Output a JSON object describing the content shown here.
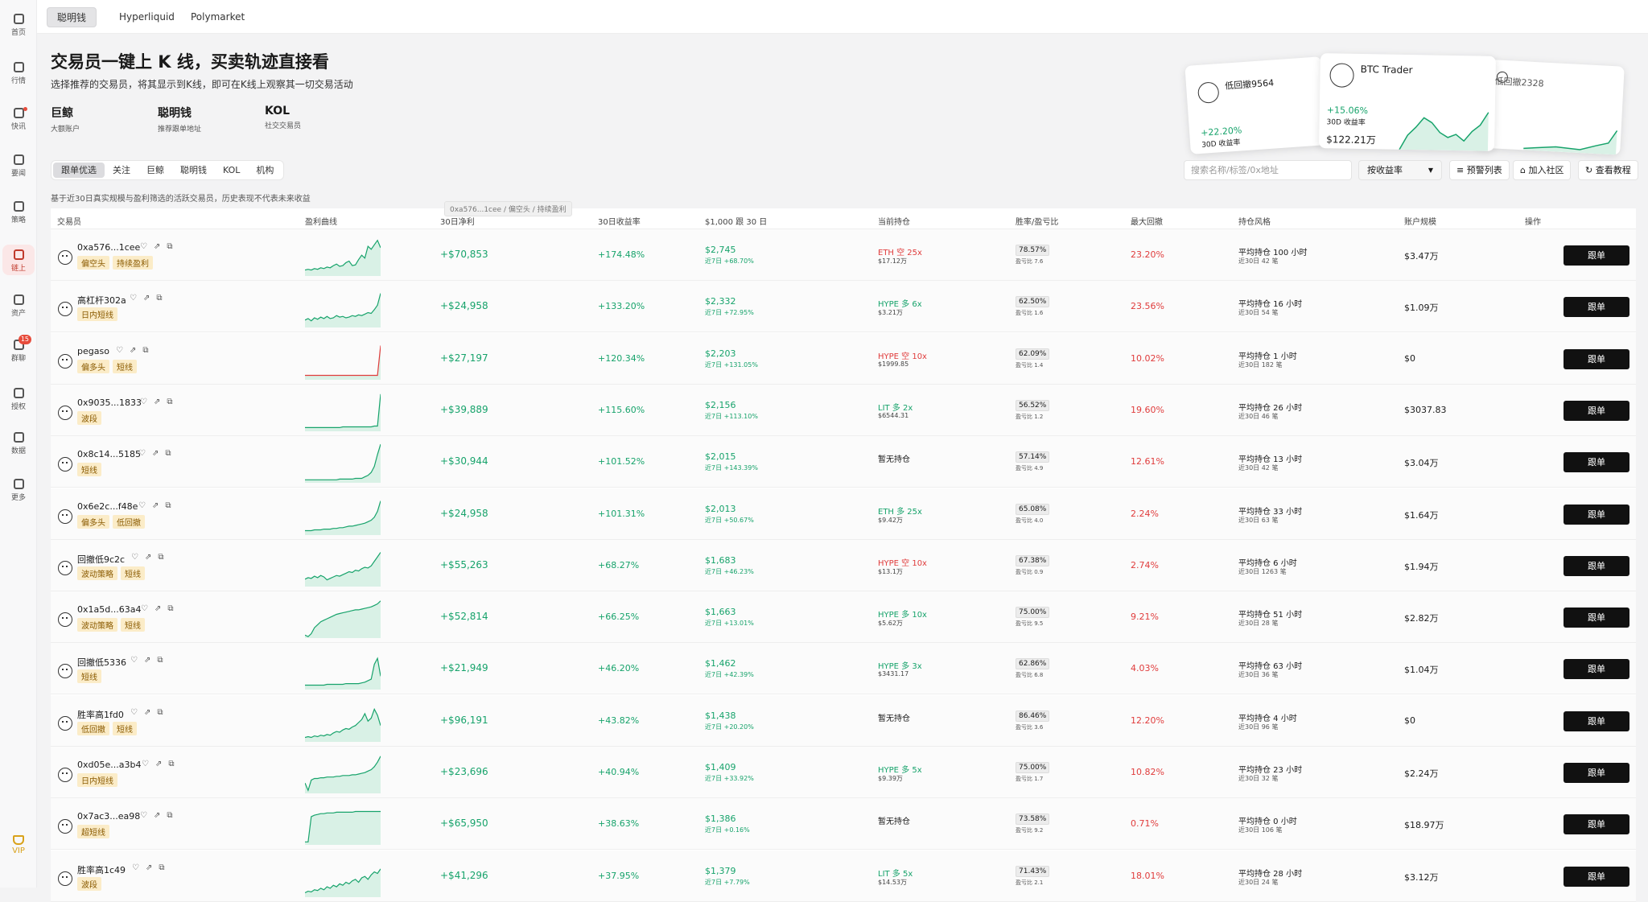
{
  "sidebar": {
    "items": [
      {
        "label": "首页",
        "icon": "home-icon"
      },
      {
        "label": "行情",
        "icon": "chart-icon"
      },
      {
        "label": "快讯",
        "icon": "news-icon"
      },
      {
        "label": "要闻",
        "icon": "article-icon"
      },
      {
        "label": "策略",
        "icon": "robot-icon"
      },
      {
        "label": "链上",
        "icon": "chain-icon"
      },
      {
        "label": "资产",
        "icon": "wallet-icon"
      },
      {
        "label": "群聊",
        "icon": "chat-icon",
        "badge": "15"
      },
      {
        "label": "授权",
        "icon": "auth-icon"
      },
      {
        "label": "数据",
        "icon": "data-icon"
      },
      {
        "label": "更多",
        "icon": "more-icon"
      }
    ],
    "vip": "VIP"
  },
  "top_tabs": [
    "聪明钱",
    "Hyperliquid",
    "Polymarket"
  ],
  "hero": {
    "title": "交易员一键上 K 线，买卖轨迹直接看",
    "subtitle": "选择推荐的交易员，将其显示到K线，即可在K线上观察其一切交易活动",
    "categories": [
      {
        "title": "巨鲸",
        "desc": "大额账户"
      },
      {
        "title": "聪明钱",
        "desc": "推荐跟单地址"
      },
      {
        "title": "KOL",
        "desc": "社交交易员"
      }
    ]
  },
  "cards": [
    {
      "name": "低回撤9564",
      "return": "+22.20%",
      "label": "30D 收益率"
    },
    {
      "name": "BTC Trader",
      "return": "+15.06%",
      "label": "30D 收益率",
      "amount": "$122.21万"
    },
    {
      "name": "低回撤2328"
    }
  ],
  "filters": [
    "跟单优选",
    "关注",
    "巨鲸",
    "聪明钱",
    "KOL",
    "机构"
  ],
  "search_placeholder": "搜索名称/标签/0x地址",
  "sort_label": "按收益率",
  "toolbar": {
    "alert": "预警列表",
    "community": "加入社区",
    "tutorial": "查看教程"
  },
  "note": "基于近30日真实规模与盈利筛选的活跃交易员，历史表现不代表未来收益",
  "tooltip": "0xa576...1cee / 偏空头 / 持续盈利",
  "columns": [
    "交易员",
    "盈利曲线",
    "30日净利",
    "30日收益率",
    "$1,000 跟 30 日",
    "当前持仓",
    "胜率/盈亏比",
    "最大回撤",
    "持仓风格",
    "账户规模",
    "操作"
  ],
  "follow_label": "跟单",
  "rows": [
    {
      "name": "0xa576...1cee",
      "tags": [
        "偏空头",
        "持续盈利"
      ],
      "pnl": "+$70,853",
      "ret": "+174.48%",
      "f1": "$2,745",
      "f2": "近7日 +68.70%",
      "h1": "ETH 空 25x",
      "h1c": "#e03c3c",
      "h2": "$17.12万",
      "wr": "78.57%",
      "pf": "盈亏比 7.6",
      "dd": "23.20%",
      "st1": "平均持仓 100 小时",
      "st2": "近30日 42 笔",
      "size": "$3.47万",
      "spark": [
        8,
        9,
        8,
        10,
        9,
        11,
        10,
        12,
        11,
        14,
        16,
        13,
        14,
        18,
        20,
        14,
        15,
        22,
        28,
        24,
        40,
        36,
        42,
        48,
        38
      ]
    },
    {
      "name": "高杠杆302a",
      "tags": [
        "日内短线"
      ],
      "pnl": "+$24,958",
      "ret": "+133.20%",
      "f1": "$2,332",
      "f2": "近7日 +72.95%",
      "h1": "HYPE 多 6x",
      "h1c": "#17a36b",
      "h2": "$3.21万",
      "wr": "62.50%",
      "pf": "盈亏比 1.6",
      "dd": "23.56%",
      "st1": "平均持仓 16 小时",
      "st2": "近30日 54 笔",
      "size": "$1.09万",
      "spark": [
        10,
        12,
        9,
        13,
        11,
        14,
        12,
        15,
        12,
        13,
        16,
        14,
        15,
        13,
        14,
        16,
        15,
        17,
        16,
        18,
        20,
        19,
        24,
        30,
        46
      ]
    },
    {
      "name": "pegaso",
      "tags": [
        "偏多头",
        "短线"
      ],
      "pnl": "+$27,197",
      "ret": "+120.34%",
      "f1": "$2,203",
      "f2": "近7日 +131.05%",
      "h1": "HYPE 空 10x",
      "h1c": "#e03c3c",
      "h2": "$1999.85",
      "wr": "62.09%",
      "pf": "盈亏比 1.4",
      "dd": "10.02%",
      "st1": "平均持仓 1 小时",
      "st2": "近30日 182 笔",
      "size": "$0",
      "spark": [
        6,
        6,
        6,
        6,
        6,
        6,
        6,
        6,
        6,
        6,
        6,
        6,
        6,
        6,
        6,
        6,
        6,
        6,
        6,
        6,
        6,
        6,
        6,
        6,
        46
      ],
      "red_start": true
    },
    {
      "name": "0x9035...1833",
      "tags": [
        "波段"
      ],
      "pnl": "+$39,889",
      "ret": "+115.60%",
      "f1": "$2,156",
      "f2": "近7日 +113.10%",
      "h1": "LIT 多 2x",
      "h1c": "#17a36b",
      "h2": "$6544.31",
      "wr": "56.52%",
      "pf": "盈亏比 1.2",
      "dd": "19.60%",
      "st1": "平均持仓 26 小时",
      "st2": "近30日 46 笔",
      "size": "$3037.83",
      "spark": [
        5,
        5,
        5,
        5,
        5,
        5,
        5,
        5,
        5,
        5,
        5,
        5,
        6,
        6,
        6,
        6,
        6,
        6,
        6,
        6,
        6,
        6,
        7,
        7,
        50
      ]
    },
    {
      "name": "0x8c14...5185",
      "tags": [
        "短线"
      ],
      "pnl": "+$30,944",
      "ret": "+101.52%",
      "f1": "$2,015",
      "f2": "近7日 +143.39%",
      "h1": "暂无持仓",
      "h1c": "#1a1a1a",
      "h2": "",
      "wr": "57.14%",
      "pf": "盈亏比 4.9",
      "dd": "12.61%",
      "st1": "平均持仓 13 小时",
      "st2": "近30日 42 笔",
      "size": "$3.04万",
      "spark": [
        4,
        4,
        4,
        4,
        4,
        4,
        4,
        4,
        4,
        4,
        4,
        5,
        5,
        5,
        5,
        5,
        6,
        6,
        6,
        8,
        10,
        14,
        22,
        38,
        52
      ]
    },
    {
      "name": "0x6e2c...f48e",
      "tags": [
        "偏多头",
        "低回撤"
      ],
      "pnl": "+$24,958",
      "ret": "+101.31%",
      "f1": "$2,013",
      "f2": "近7日 +50.67%",
      "h1": "ETH 多 25x",
      "h1c": "#17a36b",
      "h2": "$9.42万",
      "wr": "65.08%",
      "pf": "盈亏比 4.0",
      "dd": "2.24%",
      "st1": "平均持仓 33 小时",
      "st2": "近30日 63 笔",
      "size": "$1.64万",
      "spark": [
        6,
        6,
        6,
        7,
        7,
        7,
        8,
        8,
        8,
        9,
        9,
        10,
        10,
        11,
        12,
        12,
        13,
        14,
        15,
        16,
        18,
        20,
        24,
        32,
        46
      ]
    },
    {
      "name": "回撤低9c2c",
      "tags": [
        "波动策略",
        "短线"
      ],
      "pnl": "+$55,263",
      "ret": "+68.27%",
      "f1": "$1,683",
      "f2": "近7日 +46.23%",
      "h1": "HYPE 空 10x",
      "h1c": "#e03c3c",
      "h2": "$13.1万",
      "wr": "67.38%",
      "pf": "盈亏比 0.9",
      "dd": "2.74%",
      "st1": "平均持仓 6 小时",
      "st2": "近30日 1263 笔",
      "size": "$1.94万",
      "spark": [
        10,
        12,
        11,
        14,
        12,
        15,
        13,
        9,
        11,
        13,
        15,
        14,
        16,
        18,
        20,
        19,
        22,
        21,
        24,
        26,
        25,
        28,
        34,
        40,
        46
      ]
    },
    {
      "name": "0x1a5d...63a4",
      "tags": [
        "波动策略",
        "短线"
      ],
      "pnl": "+$52,814",
      "ret": "+66.25%",
      "f1": "$1,663",
      "f2": "近7日 +13.01%",
      "h1": "HYPE 多 10x",
      "h1c": "#17a36b",
      "h2": "$5.62万",
      "wr": "75.00%",
      "pf": "盈亏比 9.5",
      "dd": "9.21%",
      "st1": "平均持仓 51 小时",
      "st2": "近30日 28 笔",
      "size": "$2.82万",
      "spark": [
        4,
        2,
        6,
        14,
        18,
        22,
        24,
        26,
        28,
        30,
        32,
        33,
        34,
        35,
        36,
        37,
        38,
        38,
        39,
        40,
        41,
        42,
        44,
        46,
        50
      ]
    },
    {
      "name": "回撤低5336",
      "tags": [
        "短线"
      ],
      "pnl": "+$21,949",
      "ret": "+46.20%",
      "f1": "$1,462",
      "f2": "近7日 +42.39%",
      "h1": "HYPE 多 3x",
      "h1c": "#17a36b",
      "h2": "$3431.17",
      "wr": "62.86%",
      "pf": "盈亏比 6.8",
      "dd": "4.03%",
      "st1": "平均持仓 63 小时",
      "st2": "近30日 36 笔",
      "size": "$1.04万",
      "spark": [
        6,
        6,
        6,
        6,
        6,
        6,
        6,
        7,
        7,
        7,
        7,
        7,
        7,
        8,
        8,
        8,
        8,
        8,
        9,
        10,
        12,
        14,
        34,
        42,
        18
      ]
    },
    {
      "name": "胜率高1fd0",
      "tags": [
        "低回撤",
        "短线"
      ],
      "pnl": "+$96,191",
      "ret": "+43.82%",
      "f1": "$1,438",
      "f2": "近7日 +20.20%",
      "h1": "暂无持仓",
      "h1c": "#1a1a1a",
      "h2": "",
      "wr": "86.46%",
      "pf": "盈亏比 3.6",
      "dd": "12.20%",
      "st1": "平均持仓 4 小时",
      "st2": "近30日 96 笔",
      "size": "$0",
      "spark": [
        6,
        7,
        6,
        8,
        7,
        9,
        8,
        10,
        9,
        12,
        14,
        13,
        16,
        18,
        17,
        20,
        22,
        26,
        30,
        38,
        28,
        32,
        44,
        36,
        22
      ]
    },
    {
      "name": "0xd05e...a3b4",
      "tags": [
        "日内短线"
      ],
      "pnl": "+$23,696",
      "ret": "+40.94%",
      "f1": "$1,409",
      "f2": "近7日 +33.92%",
      "h1": "HYPE 多 5x",
      "h1c": "#17a36b",
      "h2": "$9.39万",
      "wr": "75.00%",
      "pf": "盈亏比 1.7",
      "dd": "10.82%",
      "st1": "平均持仓 23 小时",
      "st2": "近30日 32 笔",
      "size": "$2.24万",
      "spark": [
        14,
        4,
        18,
        20,
        20,
        21,
        21,
        22,
        22,
        22,
        23,
        23,
        24,
        24,
        24,
        25,
        25,
        26,
        27,
        28,
        30,
        32,
        36,
        42,
        50
      ]
    },
    {
      "name": "0x7ac3...ea98",
      "tags": [
        "超短线"
      ],
      "pnl": "+$65,950",
      "ret": "+38.63%",
      "f1": "$1,386",
      "f2": "近7日 +0.16%",
      "h1": "暂无持仓",
      "h1c": "#1a1a1a",
      "h2": "",
      "wr": "73.58%",
      "pf": "盈亏比 9.2",
      "dd": "0.71%",
      "st1": "平均持仓 0 小时",
      "st2": "近30日 106 笔",
      "size": "$18.97万",
      "spark": [
        4,
        4,
        38,
        40,
        41,
        42,
        42,
        43,
        43,
        43,
        44,
        44,
        44,
        44,
        44,
        44,
        45,
        45,
        45,
        45,
        45,
        45,
        45,
        45,
        45
      ]
    },
    {
      "name": "胜率高1c49",
      "tags": [
        "波段"
      ],
      "pnl": "+$41,296",
      "ret": "+37.95%",
      "f1": "$1,379",
      "f2": "近7日 +7.79%",
      "h1": "LIT 多 5x",
      "h1c": "#17a36b",
      "h2": "$14.53万",
      "wr": "71.43%",
      "pf": "盈亏比 2.1",
      "dd": "18.01%",
      "st1": "平均持仓 28 小时",
      "st2": "近30日 24 笔",
      "size": "$3.12万",
      "spark": [
        6,
        8,
        7,
        10,
        9,
        12,
        10,
        14,
        12,
        16,
        14,
        18,
        16,
        20,
        18,
        22,
        24,
        20,
        26,
        28,
        24,
        30,
        34,
        32,
        38
      ]
    }
  ]
}
